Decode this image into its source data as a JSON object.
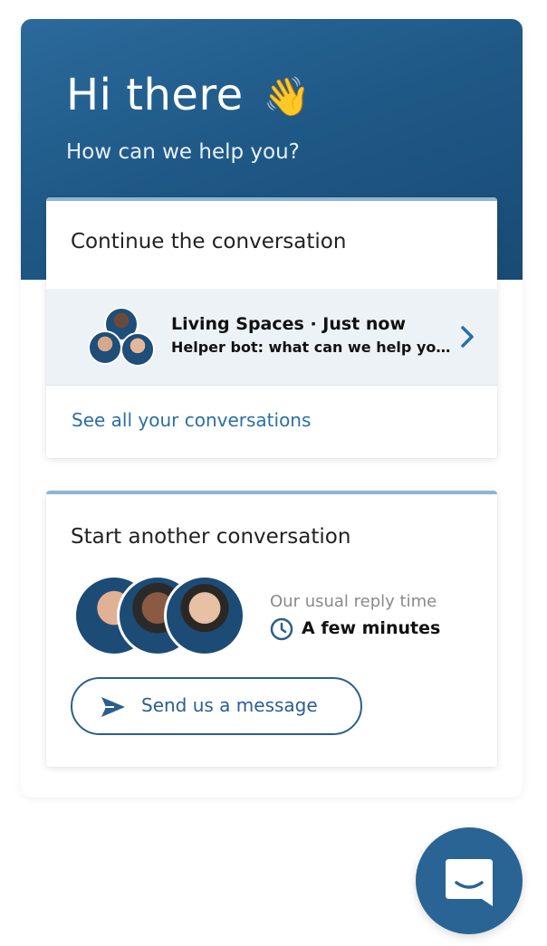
{
  "header": {
    "greeting": "Hi there",
    "wave_emoji": "👋",
    "subtitle": "How can we help you?"
  },
  "continue_card": {
    "title": "Continue the conversation",
    "conversation": {
      "name_line": "Living Spaces · Just now",
      "preview": "Helper bot: what can we help you ..."
    },
    "see_all_label": "See all your conversations"
  },
  "start_card": {
    "title": "Start another conversation",
    "reply_time_label": "Our usual reply time",
    "reply_time_value": "A few minutes",
    "send_button_label": "Send us a message"
  },
  "icons": {
    "chevron": "chevron-right-icon",
    "clock": "clock-icon",
    "send": "send-icon",
    "launcher": "chat-bubble-icon"
  },
  "colors": {
    "header_gradient_start": "#2b6a9b",
    "header_gradient_end": "#184b74",
    "accent": "#2a6fa5",
    "button_border": "#2a5f8e",
    "launcher": "#2a6494",
    "convo_row_bg": "#edf2f6"
  }
}
